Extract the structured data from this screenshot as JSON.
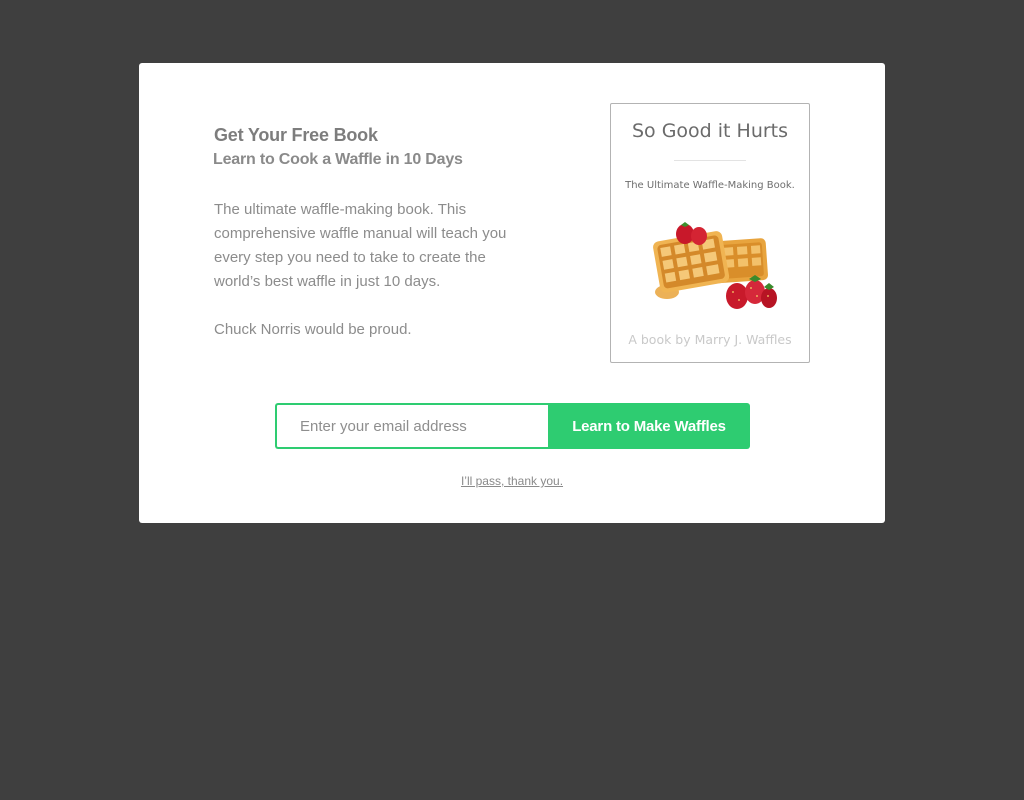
{
  "offer": {
    "heading": "Get Your Free Book",
    "subheading": "Learn to Cook a Waffle in 10 Days",
    "description": "The ultimate waffle-making book. This comprehensive waffle manual will teach you every step you need to take to create the world’s best waffle in just 10 days.",
    "tagline": "Chuck Norris would be proud."
  },
  "book": {
    "title": "So Good it Hurts",
    "subtitle": "The Ultimate Waffle-Making Book.",
    "author": "A book by Marry J. Waffles",
    "image_icon": "waffle-with-strawberries"
  },
  "form": {
    "email_placeholder": "Enter your email address",
    "email_value": "",
    "submit_label": "Learn to Make Waffles"
  },
  "decline_label": "I’ll pass, thank you.",
  "colors": {
    "overlay": "#3f3f3f",
    "accent": "#2ecc71",
    "text": "#8a8a8a"
  }
}
